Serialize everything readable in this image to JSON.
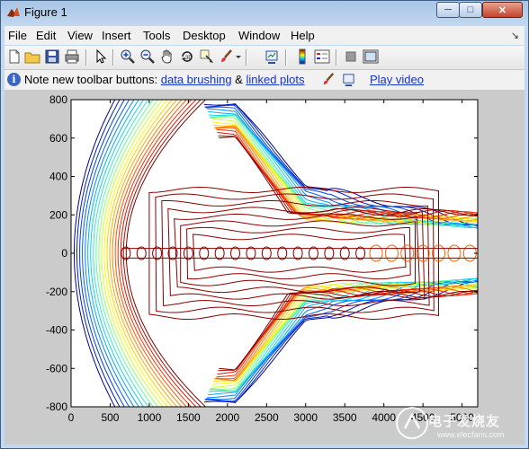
{
  "window": {
    "title": "Figure 1",
    "min_glyph": "─",
    "max_glyph": "□",
    "close_glyph": "✕"
  },
  "menu": {
    "items": [
      {
        "label": "File"
      },
      {
        "label": "Edit"
      },
      {
        "label": "View"
      },
      {
        "label": "Insert"
      },
      {
        "label": "Tools"
      },
      {
        "label": "Desktop"
      },
      {
        "label": "Window"
      },
      {
        "label": "Help"
      }
    ],
    "dock_glyph": "↘"
  },
  "toolbar": {
    "buttons": [
      "new-figure-icon",
      "open-file-icon",
      "save-icon",
      "print-icon",
      "edit-plot-arrow-icon",
      "zoom-in-icon",
      "zoom-out-icon",
      "pan-hand-icon",
      "rotate-3d-icon",
      "data-cursor-icon",
      "brush-icon",
      "brush-dropdown-icon",
      "link-plot-icon",
      "insert-colorbar-icon",
      "insert-legend-icon",
      "hide-plot-tools-icon",
      "show-plot-tools-icon"
    ]
  },
  "notice": {
    "prefix": "Note new toolbar buttons: ",
    "link1": "data brushing",
    "amp": " & ",
    "link2": "linked plots",
    "link3": "Play video"
  },
  "watermark": {
    "text": "电子发烧友",
    "sub": "www.elecfans.com"
  },
  "chart_data": {
    "type": "contour",
    "title": "",
    "xlabel": "",
    "ylabel": "",
    "xlim": [
      0,
      5200
    ],
    "ylim": [
      -800,
      800
    ],
    "xticks": [
      "0",
      "500",
      "1000",
      "1500",
      "2000",
      "2500",
      "3000",
      "3500",
      "4000",
      "4500",
      "5000"
    ],
    "yticks": [
      "800",
      "600",
      "400",
      "200",
      "0",
      "-200",
      "-400",
      "-600",
      "-800"
    ],
    "grid": false,
    "colormap": [
      "#00008f",
      "#0050ff",
      "#00c0ff",
      "#60ffa0",
      "#ffff00",
      "#ff9000",
      "#ff2000",
      "#800000"
    ]
  }
}
